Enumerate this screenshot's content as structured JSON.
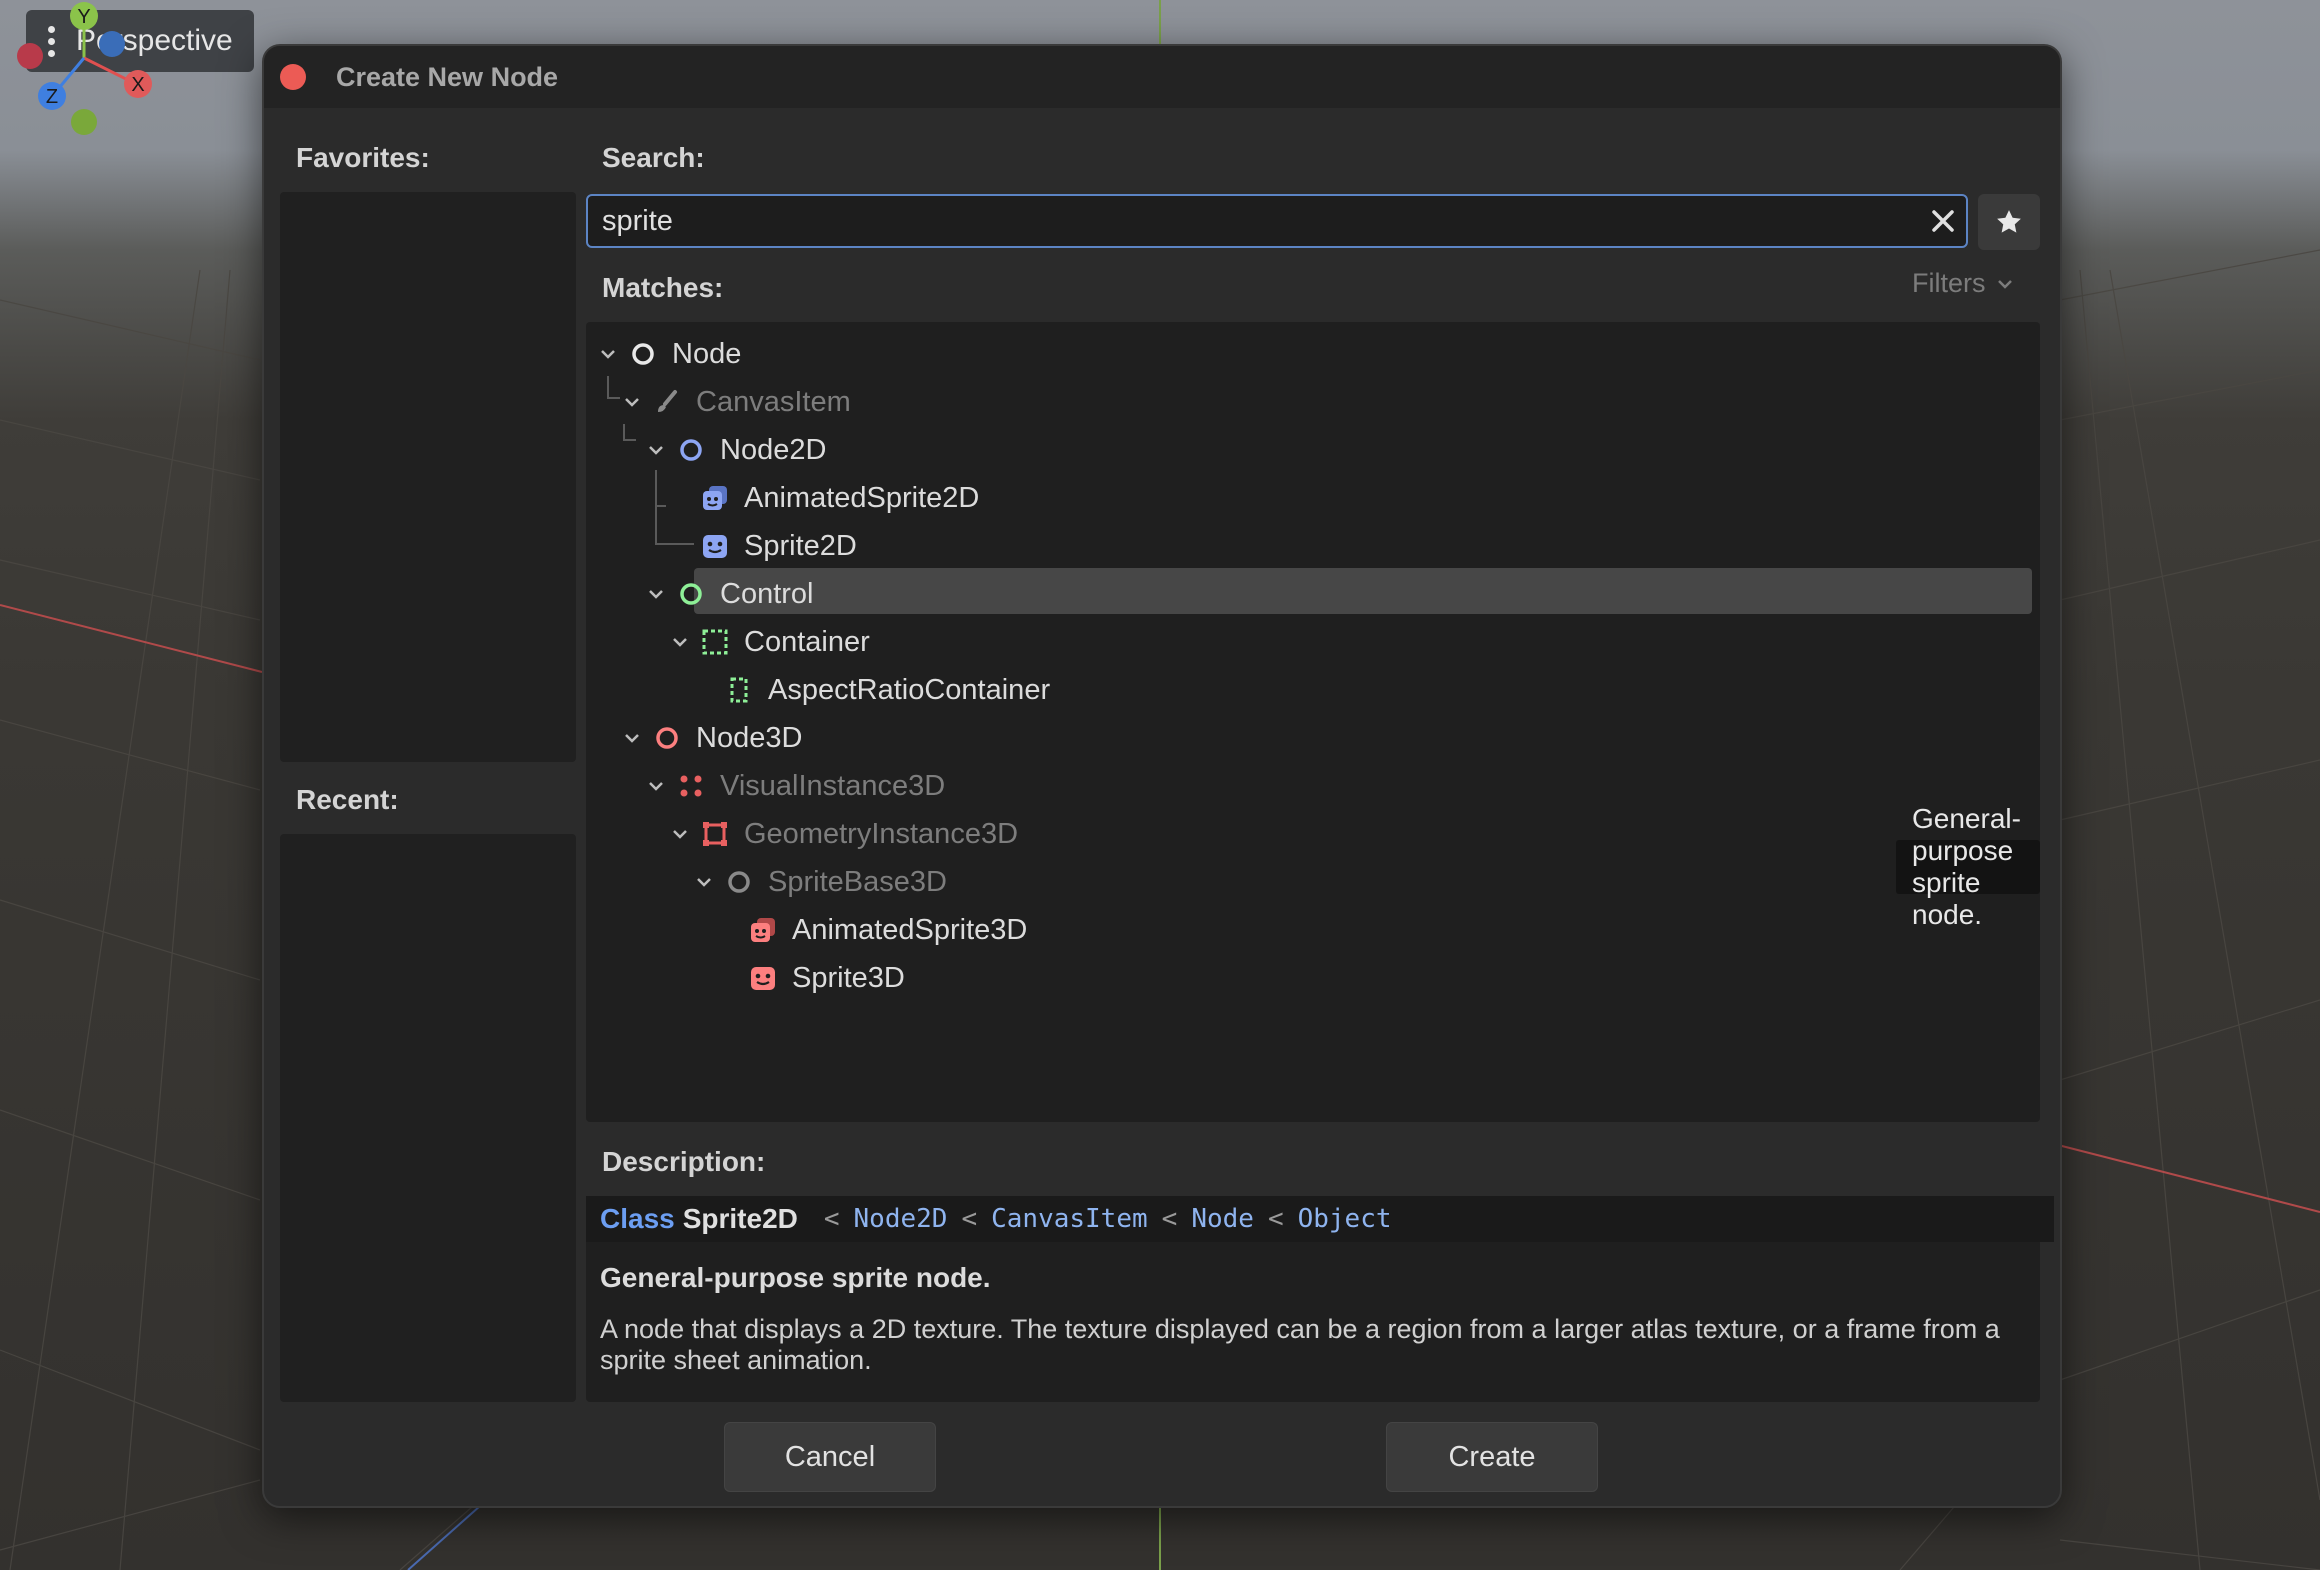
{
  "viewport": {
    "perspective_label": "Perspective",
    "gizmo": {
      "y": "Y",
      "x": "X",
      "z": "Z"
    }
  },
  "dialog": {
    "title": "Create New Node",
    "favorites_label": "Favorites:",
    "recent_label": "Recent:",
    "search_label": "Search:",
    "search_value": "sprite",
    "matches_label": "Matches:",
    "filters_label": "Filters",
    "tree": [
      {
        "label": "Node",
        "dim": false,
        "icon": "node-icon"
      },
      {
        "label": "CanvasItem",
        "dim": true,
        "icon": "brush-icon"
      },
      {
        "label": "Node2D",
        "dim": false,
        "icon": "node2d-icon"
      },
      {
        "label": "AnimatedSprite2D",
        "dim": false,
        "icon": "animated-sprite-2d-icon"
      },
      {
        "label": "Sprite2D",
        "dim": false,
        "icon": "sprite-2d-icon",
        "selected": true
      },
      {
        "label": "Control",
        "dim": false,
        "icon": "control-icon"
      },
      {
        "label": "Container",
        "dim": false,
        "icon": "container-icon"
      },
      {
        "label": "AspectRatioContainer",
        "dim": false,
        "icon": "aspect-ratio-container-icon"
      },
      {
        "label": "Node3D",
        "dim": false,
        "icon": "node3d-icon"
      },
      {
        "label": "VisualInstance3D",
        "dim": true,
        "icon": "visual-instance-icon"
      },
      {
        "label": "GeometryInstance3D",
        "dim": true,
        "icon": "geometry-instance-icon"
      },
      {
        "label": "SpriteBase3D",
        "dim": true,
        "icon": "sprite-base-icon"
      },
      {
        "label": "AnimatedSprite3D",
        "dim": false,
        "icon": "animated-sprite-3d-icon"
      },
      {
        "label": "Sprite3D",
        "dim": false,
        "icon": "sprite-3d-icon"
      }
    ],
    "tooltip": "General-purpose sprite node.",
    "description_label": "Description:",
    "description": {
      "class_keyword": "Class",
      "class_name": "Sprite2D",
      "separator": "<",
      "inherits": [
        "Node2D",
        "CanvasItem",
        "Node",
        "Object"
      ],
      "brief": "General-purpose sprite node.",
      "body": "A node that displays a 2D texture. The texture displayed can be a region from a larger atlas texture, or a frame from a sprite sheet animation."
    },
    "cancel_label": "Cancel",
    "create_label": "Create"
  },
  "colors": {
    "accent_blue": "#6c9ef2",
    "node2d_blue": "#8da5f3",
    "control_green": "#8eef97",
    "node3d_red": "#fc7f7f",
    "close_red": "#ec5b55"
  }
}
